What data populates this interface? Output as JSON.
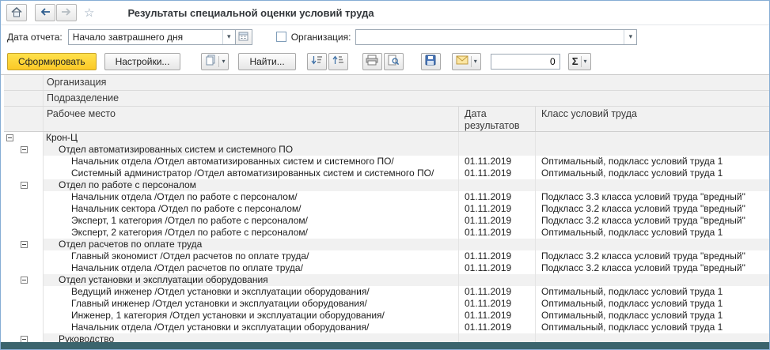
{
  "window": {
    "title": "Результаты специальной оценки условий труда"
  },
  "filters": {
    "date_label": "Дата отчета:",
    "date_value": "Начало завтрашнего дня",
    "org_checkbox_checked": false,
    "org_label": "Организация:",
    "org_value": ""
  },
  "toolbar": {
    "generate_label": "Сформировать",
    "settings_label": "Настройки...",
    "find_label": "Найти...",
    "counter_value": "0",
    "sigma_label": "Σ"
  },
  "table": {
    "header_org": "Организация",
    "header_dept": "Подразделение",
    "header_workplace": "Рабочее место",
    "header_date": "Дата результатов",
    "header_class": "Класс условий труда",
    "rows": [
      {
        "group": true,
        "level": 0,
        "expander": true,
        "text": "Крон-Ц",
        "date": "",
        "class": ""
      },
      {
        "group": true,
        "level": 1,
        "expander": true,
        "text": "Отдел автоматизированных систем и системного ПО",
        "date": "",
        "class": ""
      },
      {
        "group": false,
        "level": 2,
        "expander": false,
        "text": "Начальник отдела /Отдел автоматизированных систем и системного ПО/",
        "date": "01.11.2019",
        "class": "Оптимальный, подкласс условий труда 1"
      },
      {
        "group": false,
        "level": 2,
        "expander": false,
        "text": "Системный администратор /Отдел автоматизированных систем и системного ПО/",
        "date": "01.11.2019",
        "class": "Оптимальный, подкласс условий труда 1"
      },
      {
        "group": true,
        "level": 1,
        "expander": true,
        "text": "Отдел по работе с персоналом",
        "date": "",
        "class": ""
      },
      {
        "group": false,
        "level": 2,
        "expander": false,
        "text": "Начальник отдела /Отдел по работе с персоналом/",
        "date": "01.11.2019",
        "class": "Подкласс 3.3 класса условий труда \"вредный\""
      },
      {
        "group": false,
        "level": 2,
        "expander": false,
        "text": "Начальник сектора /Отдел по работе с персоналом/",
        "date": "01.11.2019",
        "class": "Подкласс 3.2 класса условий труда \"вредный\""
      },
      {
        "group": false,
        "level": 2,
        "expander": false,
        "text": "Эксперт, 1 категория /Отдел по работе с персоналом/",
        "date": "01.11.2019",
        "class": "Подкласс 3.2 класса условий труда \"вредный\""
      },
      {
        "group": false,
        "level": 2,
        "expander": false,
        "text": "Эксперт, 2 категория /Отдел по работе с персоналом/",
        "date": "01.11.2019",
        "class": "Оптимальный, подкласс условий труда 1"
      },
      {
        "group": true,
        "level": 1,
        "expander": true,
        "text": "Отдел расчетов по оплате труда",
        "date": "",
        "class": ""
      },
      {
        "group": false,
        "level": 2,
        "expander": false,
        "text": "Главный экономист /Отдел расчетов по оплате труда/",
        "date": "01.11.2019",
        "class": "Подкласс 3.2 класса условий труда \"вредный\""
      },
      {
        "group": false,
        "level": 2,
        "expander": false,
        "text": "Начальник отдела /Отдел расчетов по оплате труда/",
        "date": "01.11.2019",
        "class": "Подкласс 3.2 класса условий труда \"вредный\""
      },
      {
        "group": true,
        "level": 1,
        "expander": true,
        "text": "Отдел установки и эксплуатации оборудования",
        "date": "",
        "class": ""
      },
      {
        "group": false,
        "level": 2,
        "expander": false,
        "text": "Ведущий инженер /Отдел установки и эксплуатации оборудования/",
        "date": "01.11.2019",
        "class": "Оптимальный, подкласс условий труда 1"
      },
      {
        "group": false,
        "level": 2,
        "expander": false,
        "text": "Главный инженер /Отдел установки и эксплуатации оборудования/",
        "date": "01.11.2019",
        "class": "Оптимальный, подкласс условий труда 1"
      },
      {
        "group": false,
        "level": 2,
        "expander": false,
        "text": "Инженер, 1 категория /Отдел установки и эксплуатации оборудования/",
        "date": "01.11.2019",
        "class": "Оптимальный, подкласс условий труда 1"
      },
      {
        "group": false,
        "level": 2,
        "expander": false,
        "text": "Начальник отдела /Отдел установки и эксплуатации оборудования/",
        "date": "01.11.2019",
        "class": "Оптимальный, подкласс условий труда 1"
      },
      {
        "group": true,
        "level": 1,
        "expander": true,
        "text": "Руководство",
        "date": "",
        "class": ""
      }
    ]
  },
  "colors": {
    "accent_yellow": "#FBC926",
    "window_border": "#86ADD4",
    "header_bg": "#F1F1F1",
    "group_row_bg": "#F1F1F1",
    "bottom_bar": "#3B646D"
  }
}
